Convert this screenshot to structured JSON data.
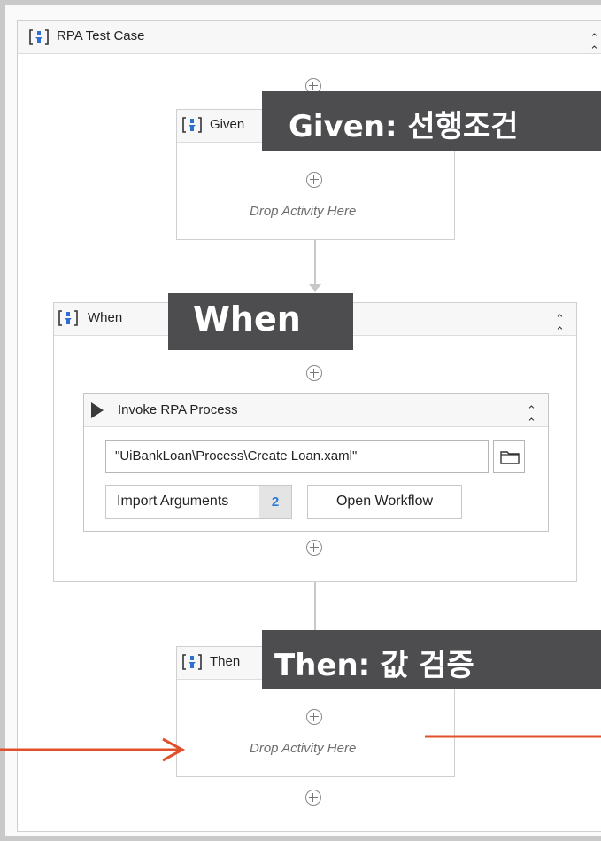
{
  "outer": {
    "title": "RPA Test Case"
  },
  "given": {
    "title": "Given",
    "drop_text": "Drop Activity Here",
    "overlay": "Given: 선행조건"
  },
  "when": {
    "title": "When",
    "overlay": "When"
  },
  "invoke": {
    "title": "Invoke RPA Process",
    "path_value": "\"UiBankLoan\\Process\\Create Loan.xaml\"",
    "import_label": "Import Arguments",
    "import_count": "2",
    "open_label": "Open Workflow"
  },
  "then": {
    "title": "Then",
    "drop_text": "Drop Activity Here",
    "overlay": "Then: 값 검증"
  },
  "colors": {
    "annotation_arrow": "#e0502a",
    "overlay_bg": "#4d4d4f",
    "icon_blue": "#2f6fd1",
    "count_badge": "#2a7ad5"
  },
  "icons": [
    "sequence-icon",
    "collapse-icon",
    "add-activity-icon",
    "play-icon",
    "folder-icon",
    "arrow-annotation"
  ]
}
